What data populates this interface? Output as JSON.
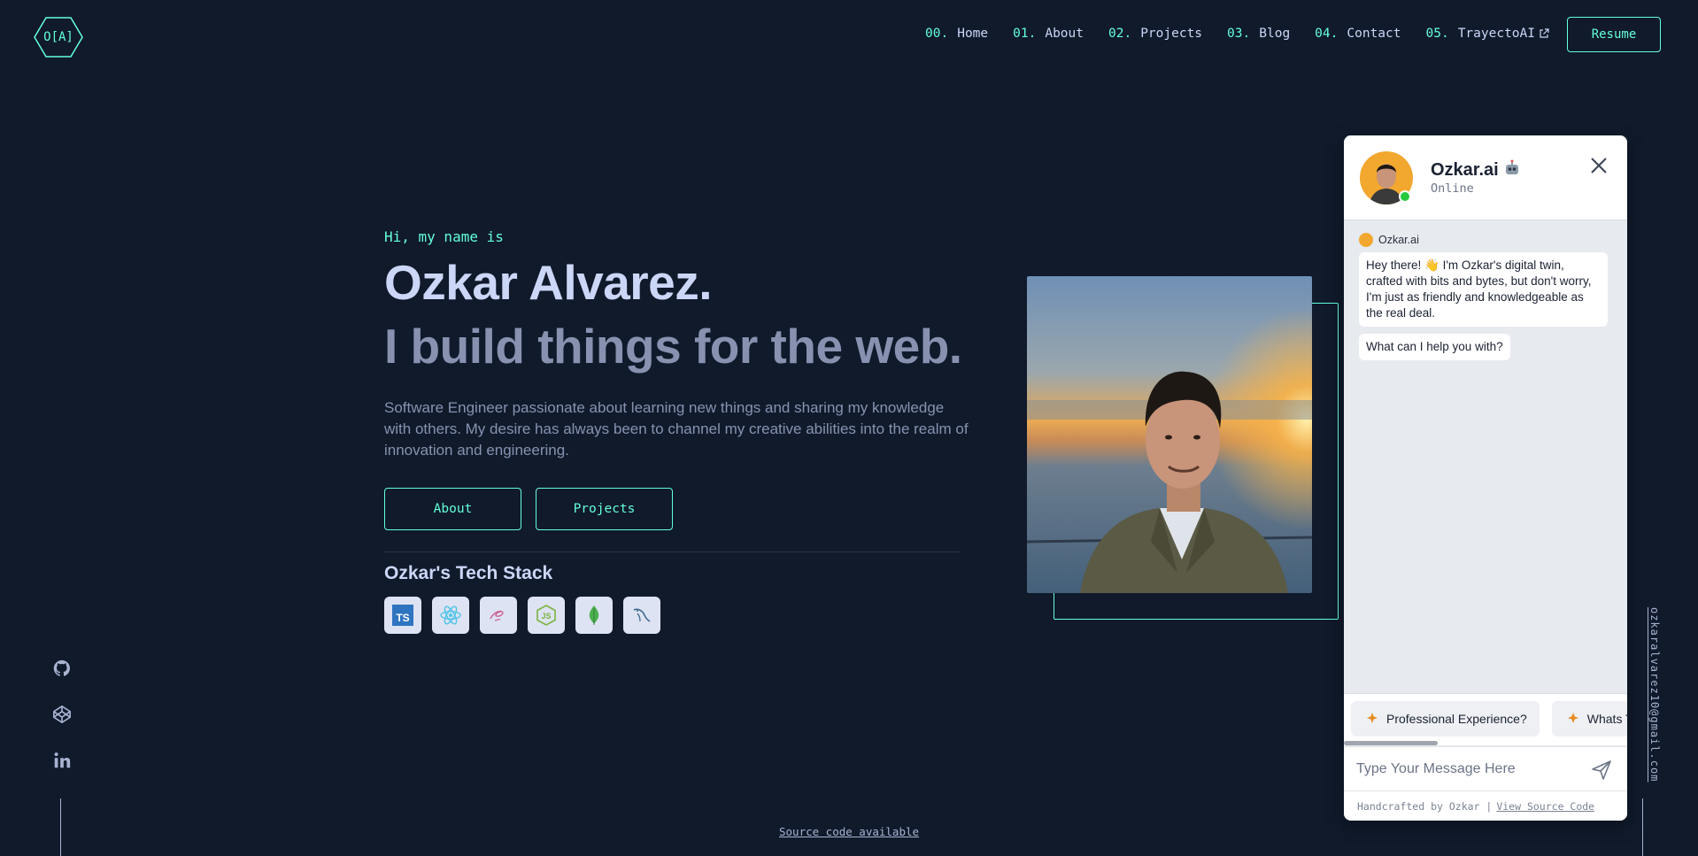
{
  "header": {
    "logo_text": "O[A]",
    "nav": [
      {
        "num": "00.",
        "label": "Home"
      },
      {
        "num": "01.",
        "label": "About"
      },
      {
        "num": "02.",
        "label": "Projects"
      },
      {
        "num": "03.",
        "label": "Blog"
      },
      {
        "num": "04.",
        "label": "Contact"
      },
      {
        "num": "05.",
        "label": "TrayectoAI",
        "external_icon": "external-link-icon"
      }
    ],
    "resume_label": "Resume"
  },
  "hero": {
    "greeting": "Hi, my name is",
    "name": "Ozkar Alvarez.",
    "tagline": "I build things for the web.",
    "bio": "Software Engineer passionate about learning new things and sharing my knowledge with others. My desire has always been to channel my creative abilities into the realm of innovation and engineering.",
    "buttons": {
      "about": "About",
      "projects": "Projects"
    },
    "stack_title": "Ozkar's Tech Stack",
    "stack_icons": [
      "typescript-icon",
      "react-icon",
      "sass-icon",
      "nodejs-icon",
      "mongodb-icon",
      "mysql-icon"
    ]
  },
  "socials": [
    "github-icon",
    "codepen-icon",
    "linkedin-icon"
  ],
  "email": "ozkaralvarez10@gmail.com",
  "footer": {
    "source_link": "Source code available"
  },
  "chat": {
    "name": "Ozkar.ai",
    "status": "Online",
    "sender": "Ozkar.ai",
    "messages": [
      "Hey there! 👋 I'm Ozkar's digital twin, crafted with bits and bytes, but don't worry, I'm just as friendly and knowledgeable as the real deal.",
      "What can I help you with?"
    ],
    "suggestions": [
      "Professional Experience?",
      "Whats T"
    ],
    "input_placeholder": "Type Your Message Here",
    "footer_text": "Handcrafted by Ozkar |",
    "footer_link": "View Source Code"
  },
  "colors": {
    "background": "#101a2b",
    "accent": "#64ffda",
    "heading": "#ccd6f6",
    "muted": "#8892b0"
  }
}
